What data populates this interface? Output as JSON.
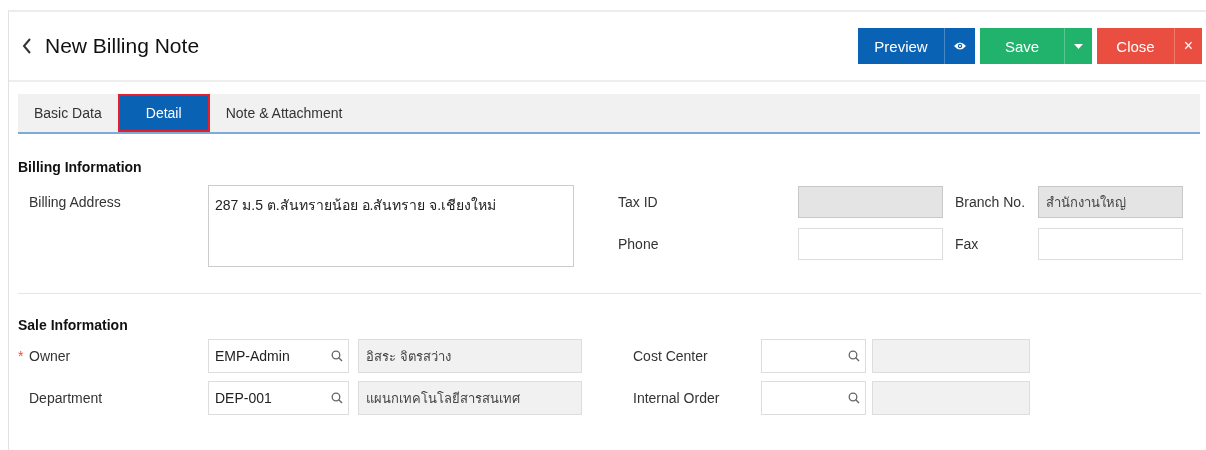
{
  "header": {
    "title": "New Billing Note",
    "buttons": [
      {
        "kind": "preview",
        "label": "Preview"
      },
      {
        "kind": "save",
        "label": "Save"
      },
      {
        "kind": "close",
        "label": "Close",
        "icon": "×"
      }
    ]
  },
  "tabs": [
    {
      "label": "Basic Data",
      "selected": false
    },
    {
      "label": "Detail",
      "selected": true
    },
    {
      "label": "Note & Attachment",
      "selected": false
    }
  ],
  "billing_information": {
    "title": "Billing Information",
    "address": {
      "label": "Billing Address",
      "value": "287 ม.5 ต.สันทรายน้อย อ.สันทราย จ.เชียงใหม่"
    },
    "fields": [
      {
        "label": "Tax ID",
        "disabled": true
      },
      {
        "label": "Branch No.",
        "disabled": true,
        "value": "สำนักงานใหญ่"
      },
      {
        "label": "Phone",
        "disabled": false
      },
      {
        "label": "Fax",
        "disabled": false
      }
    ]
  },
  "sale_information": {
    "title": "Sale Information",
    "required_mark": "*",
    "rows": [
      {
        "label": "Owner",
        "required": true,
        "code": "EMP-Admin",
        "name": "อิสระ จิตรสว่าง"
      },
      {
        "label": "Department",
        "required": false,
        "code": "DEP-001",
        "name": "แผนกเทคโนโลยีสารสนเทศ"
      },
      {
        "label": "Cost Center",
        "required": false
      },
      {
        "label": "Internal Order",
        "required": false
      }
    ]
  }
}
